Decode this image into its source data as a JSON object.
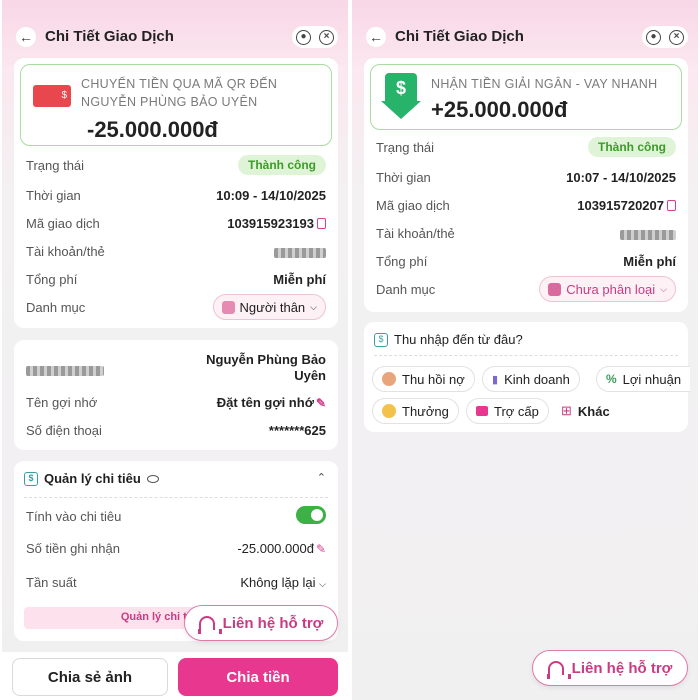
{
  "header": {
    "title": "Chi Tiết Giao Dịch"
  },
  "left": {
    "hero": {
      "title_line1": "CHUYỂN TIỀN QUA MÃ QR ĐẾN",
      "title_line2": "NGUYỄN PHÙNG BẢO UYÊN",
      "amount": "-25.000.000đ"
    },
    "details": {
      "status_label": "Trạng thái",
      "status_value": "Thành công",
      "time_label": "Thời gian",
      "time_value": "10:09 - 14/10/2025",
      "txid_label": "Mã giao dịch",
      "txid_value": "103915923193",
      "account_label": "Tài khoản/thẻ",
      "fee_label": "Tổng phí",
      "fee_value": "Miễn phí",
      "category_label": "Danh mục",
      "category_value": "Người thân"
    },
    "recipient": {
      "name_line1": "Nguyễn Phùng Bảo",
      "name_line2": "Uyên",
      "nickname_label": "Tên gợi nhớ",
      "nickname_action": "Đặt tên gợi nhớ",
      "phone_label": "Số điện thoại",
      "phone_value": "*******625"
    },
    "spending": {
      "title": "Quản lý chi tiêu",
      "count_label": "Tính vào chi tiêu",
      "recorded_label": "Số tiền ghi nhận",
      "recorded_value": "-25.000.000đ",
      "frequency_label": "Tần suất",
      "frequency_value": "Không lặp lại",
      "manage_link": "Quản lý chi tiê"
    },
    "support_label": "Liên hệ hỗ trợ",
    "share_label": "Chia sẻ ảnh",
    "split_label": "Chia tiền"
  },
  "right": {
    "hero": {
      "title": "NHẬN TIỀN GIẢI NGÂN - VAY NHANH",
      "amount": "+25.000.000đ"
    },
    "details": {
      "status_label": "Trạng thái",
      "status_value": "Thành công",
      "time_label": "Thời gian",
      "time_value": "10:07 - 14/10/2025",
      "txid_label": "Mã giao dịch",
      "txid_value": "103915720207",
      "account_label": "Tài khoản/thẻ",
      "fee_label": "Tổng phí",
      "fee_value": "Miễn phí",
      "category_label": "Danh mục",
      "category_value": "Chưa phân loại"
    },
    "income": {
      "title": "Thu nhập đến từ đâu?",
      "options": [
        "Thu hồi nợ",
        "Kinh doanh",
        "Lợi nhuận",
        "Thưởng",
        "Trợ cấp",
        "Khác"
      ]
    },
    "support_label": "Liên hệ hỗ trợ"
  },
  "colors": {
    "brand_pink": "#e8378e",
    "success_green": "#3d9a2b",
    "toggle_green": "#3db046"
  },
  "icons": [
    "back-icon",
    "support-icon",
    "close-icon",
    "copy-icon",
    "pencil-icon",
    "eye-icon",
    "headset-icon",
    "transfer-icon",
    "money-down-icon"
  ]
}
